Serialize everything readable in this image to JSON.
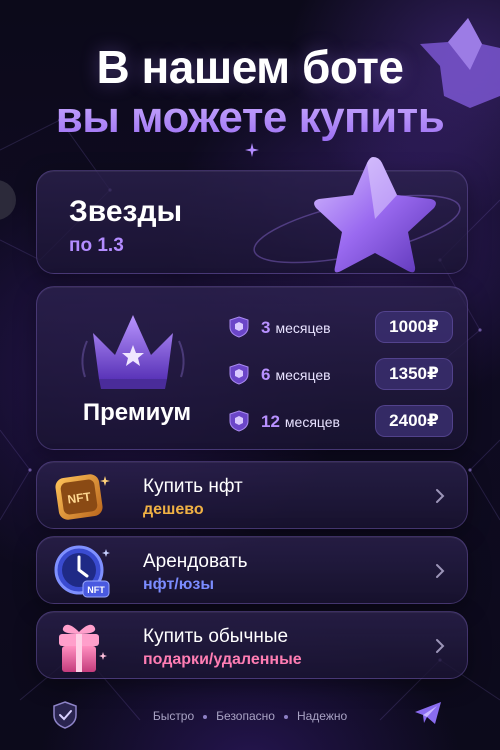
{
  "header": {
    "line1": "В нашем боте",
    "line2": "вы можете купить"
  },
  "stars_card": {
    "title": "Звезды",
    "subtitle": "по 1.3"
  },
  "premium_card": {
    "title": "Премиум",
    "plans": [
      {
        "months": "3",
        "unit": "месяцев",
        "price": "1000₽"
      },
      {
        "months": "6",
        "unit": "месяцев",
        "price": "1350₽"
      },
      {
        "months": "12",
        "unit": "месяцев",
        "price": "2400₽"
      }
    ]
  },
  "menu": [
    {
      "title": "Купить нфт",
      "subtitle": "дешево",
      "icon": "nft-badge-icon",
      "icon_text": "NFT"
    },
    {
      "title": "Арендовать",
      "subtitle": "нфт/юзы",
      "icon": "clock-icon",
      "icon_text": "NFT"
    },
    {
      "title": "Купить обычные",
      "subtitle": "подарки/удаленные",
      "icon": "gift-icon"
    }
  ],
  "footer": {
    "items": [
      "Быстро",
      "Безопасно",
      "Надежно"
    ]
  },
  "colors": {
    "background": "#0c0a1a",
    "accent_purple": "#b691ff",
    "gold": "#f0b144",
    "blue": "#7b8cff",
    "pink": "#ff7db3"
  }
}
